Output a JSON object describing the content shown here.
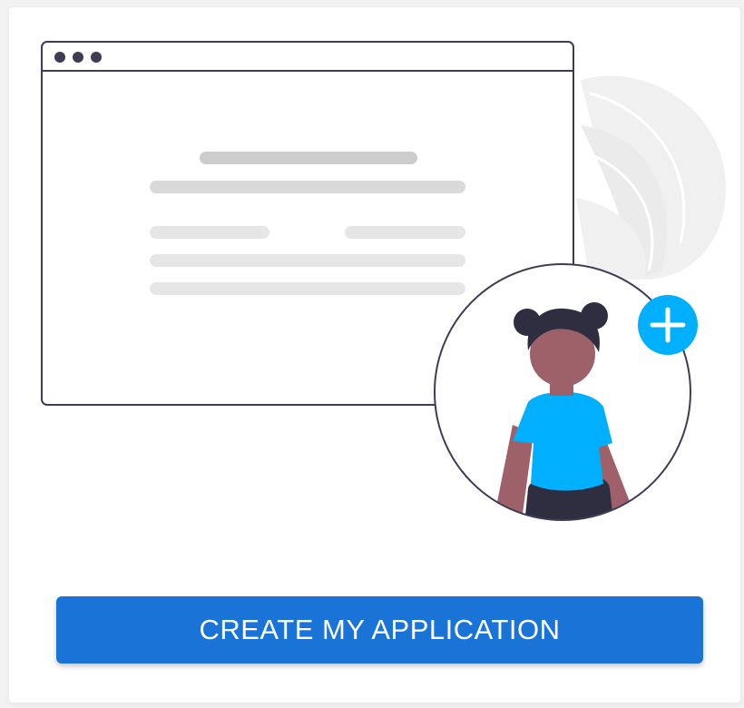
{
  "colors": {
    "accent": "#1a73d6",
    "shirt": "#00b0ff",
    "plus_badge": "#00b0ff",
    "hair": "#2f2e41",
    "skin": "#9e616a",
    "outline": "#3f3d56",
    "placeholder_line": "#e6e6e6",
    "placeholder_line_dark": "#cccccc",
    "leaf": "#f0f0f0"
  },
  "illustration": {
    "browser_window_dots": 3,
    "badge_icon": "plus-icon"
  },
  "cta": {
    "label": "CREATE MY APPLICATION"
  }
}
